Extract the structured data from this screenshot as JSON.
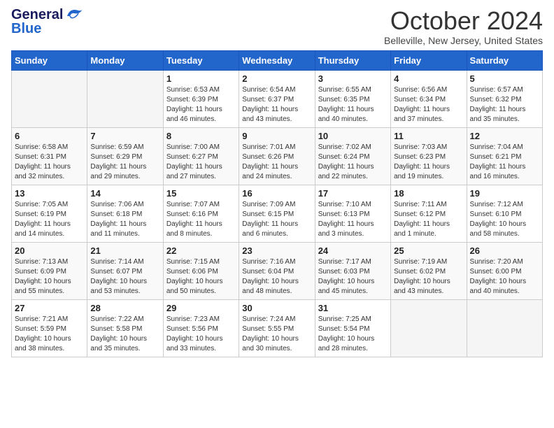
{
  "logo": {
    "line1": "General",
    "line2": "Blue"
  },
  "header": {
    "month": "October 2024",
    "location": "Belleville, New Jersey, United States"
  },
  "days_of_week": [
    "Sunday",
    "Monday",
    "Tuesday",
    "Wednesday",
    "Thursday",
    "Friday",
    "Saturday"
  ],
  "weeks": [
    [
      {
        "day": "",
        "info": ""
      },
      {
        "day": "",
        "info": ""
      },
      {
        "day": "1",
        "info": "Sunrise: 6:53 AM\nSunset: 6:39 PM\nDaylight: 11 hours\nand 46 minutes."
      },
      {
        "day": "2",
        "info": "Sunrise: 6:54 AM\nSunset: 6:37 PM\nDaylight: 11 hours\nand 43 minutes."
      },
      {
        "day": "3",
        "info": "Sunrise: 6:55 AM\nSunset: 6:35 PM\nDaylight: 11 hours\nand 40 minutes."
      },
      {
        "day": "4",
        "info": "Sunrise: 6:56 AM\nSunset: 6:34 PM\nDaylight: 11 hours\nand 37 minutes."
      },
      {
        "day": "5",
        "info": "Sunrise: 6:57 AM\nSunset: 6:32 PM\nDaylight: 11 hours\nand 35 minutes."
      }
    ],
    [
      {
        "day": "6",
        "info": "Sunrise: 6:58 AM\nSunset: 6:31 PM\nDaylight: 11 hours\nand 32 minutes."
      },
      {
        "day": "7",
        "info": "Sunrise: 6:59 AM\nSunset: 6:29 PM\nDaylight: 11 hours\nand 29 minutes."
      },
      {
        "day": "8",
        "info": "Sunrise: 7:00 AM\nSunset: 6:27 PM\nDaylight: 11 hours\nand 27 minutes."
      },
      {
        "day": "9",
        "info": "Sunrise: 7:01 AM\nSunset: 6:26 PM\nDaylight: 11 hours\nand 24 minutes."
      },
      {
        "day": "10",
        "info": "Sunrise: 7:02 AM\nSunset: 6:24 PM\nDaylight: 11 hours\nand 22 minutes."
      },
      {
        "day": "11",
        "info": "Sunrise: 7:03 AM\nSunset: 6:23 PM\nDaylight: 11 hours\nand 19 minutes."
      },
      {
        "day": "12",
        "info": "Sunrise: 7:04 AM\nSunset: 6:21 PM\nDaylight: 11 hours\nand 16 minutes."
      }
    ],
    [
      {
        "day": "13",
        "info": "Sunrise: 7:05 AM\nSunset: 6:19 PM\nDaylight: 11 hours\nand 14 minutes."
      },
      {
        "day": "14",
        "info": "Sunrise: 7:06 AM\nSunset: 6:18 PM\nDaylight: 11 hours\nand 11 minutes."
      },
      {
        "day": "15",
        "info": "Sunrise: 7:07 AM\nSunset: 6:16 PM\nDaylight: 11 hours\nand 8 minutes."
      },
      {
        "day": "16",
        "info": "Sunrise: 7:09 AM\nSunset: 6:15 PM\nDaylight: 11 hours\nand 6 minutes."
      },
      {
        "day": "17",
        "info": "Sunrise: 7:10 AM\nSunset: 6:13 PM\nDaylight: 11 hours\nand 3 minutes."
      },
      {
        "day": "18",
        "info": "Sunrise: 7:11 AM\nSunset: 6:12 PM\nDaylight: 11 hours\nand 1 minute."
      },
      {
        "day": "19",
        "info": "Sunrise: 7:12 AM\nSunset: 6:10 PM\nDaylight: 10 hours\nand 58 minutes."
      }
    ],
    [
      {
        "day": "20",
        "info": "Sunrise: 7:13 AM\nSunset: 6:09 PM\nDaylight: 10 hours\nand 55 minutes."
      },
      {
        "day": "21",
        "info": "Sunrise: 7:14 AM\nSunset: 6:07 PM\nDaylight: 10 hours\nand 53 minutes."
      },
      {
        "day": "22",
        "info": "Sunrise: 7:15 AM\nSunset: 6:06 PM\nDaylight: 10 hours\nand 50 minutes."
      },
      {
        "day": "23",
        "info": "Sunrise: 7:16 AM\nSunset: 6:04 PM\nDaylight: 10 hours\nand 48 minutes."
      },
      {
        "day": "24",
        "info": "Sunrise: 7:17 AM\nSunset: 6:03 PM\nDaylight: 10 hours\nand 45 minutes."
      },
      {
        "day": "25",
        "info": "Sunrise: 7:19 AM\nSunset: 6:02 PM\nDaylight: 10 hours\nand 43 minutes."
      },
      {
        "day": "26",
        "info": "Sunrise: 7:20 AM\nSunset: 6:00 PM\nDaylight: 10 hours\nand 40 minutes."
      }
    ],
    [
      {
        "day": "27",
        "info": "Sunrise: 7:21 AM\nSunset: 5:59 PM\nDaylight: 10 hours\nand 38 minutes."
      },
      {
        "day": "28",
        "info": "Sunrise: 7:22 AM\nSunset: 5:58 PM\nDaylight: 10 hours\nand 35 minutes."
      },
      {
        "day": "29",
        "info": "Sunrise: 7:23 AM\nSunset: 5:56 PM\nDaylight: 10 hours\nand 33 minutes."
      },
      {
        "day": "30",
        "info": "Sunrise: 7:24 AM\nSunset: 5:55 PM\nDaylight: 10 hours\nand 30 minutes."
      },
      {
        "day": "31",
        "info": "Sunrise: 7:25 AM\nSunset: 5:54 PM\nDaylight: 10 hours\nand 28 minutes."
      },
      {
        "day": "",
        "info": ""
      },
      {
        "day": "",
        "info": ""
      }
    ]
  ]
}
